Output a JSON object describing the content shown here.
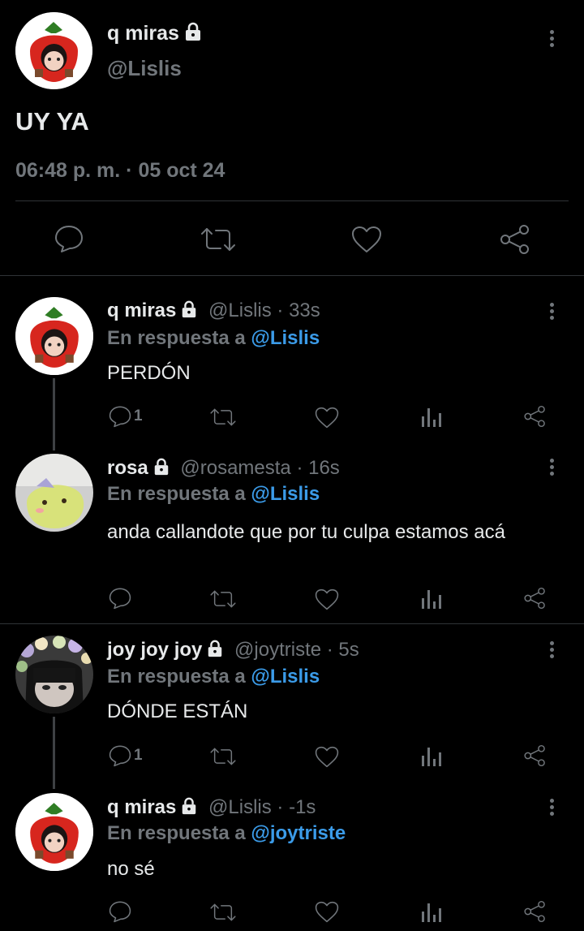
{
  "main_tweet": {
    "display_name": "q miras",
    "handle": "@Lislis",
    "text": "UY YA",
    "timestamp": "06:48 p. m. · 05 oct 24"
  },
  "replies": [
    {
      "display_name": "q miras",
      "meta": "@Lislis · 33s",
      "reply_prefix": "En respuesta a",
      "reply_to": "@Lislis",
      "text": "PERDÓN",
      "reply_count": "1"
    },
    {
      "display_name": "rosa",
      "meta": "@rosamesta · 16s",
      "reply_prefix": "En respuesta a",
      "reply_to": "@Lislis",
      "text": "anda callandote que por tu culpa estamos acá",
      "reply_count": ""
    },
    {
      "display_name": "joy joy joy",
      "meta": "@joytriste · 5s",
      "reply_prefix": "En respuesta a",
      "reply_to": "@Lislis",
      "text": "DÓNDE ESTÁN",
      "reply_count": "1"
    },
    {
      "display_name": "q miras",
      "meta": "@Lislis · -1s",
      "reply_prefix": "En respuesta a",
      "reply_to": "@joytriste",
      "text": "no sé",
      "reply_count": ""
    }
  ],
  "colors": {
    "background": "#000000",
    "text": "#e7e9ea",
    "muted": "#71767b",
    "link": "#3b9be8",
    "divider": "#2f3336"
  },
  "icons": [
    "lock-icon",
    "more-icon",
    "reply-icon",
    "retweet-icon",
    "like-icon",
    "share-icon",
    "analytics-icon"
  ]
}
